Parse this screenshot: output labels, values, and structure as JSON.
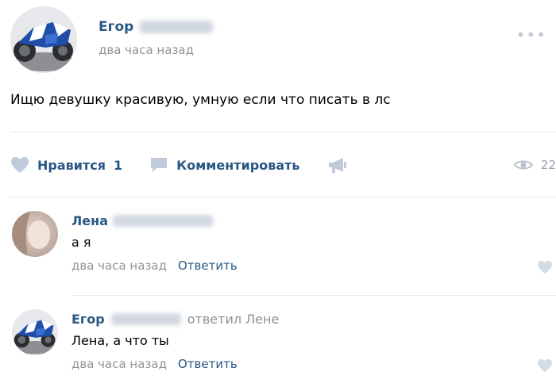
{
  "post": {
    "author": "Егор",
    "time": "два часа назад",
    "text": "Ищю девушку красивую, умную если что писать в лс",
    "more_icon": "dots-icon"
  },
  "actions": {
    "like_label": "Нравится",
    "like_count": "1",
    "comment_label": "Комментировать",
    "views_count": "22"
  },
  "comments": [
    {
      "author": "Лена",
      "text": "а я",
      "time": "два часа назад",
      "reply_label": "Ответить"
    },
    {
      "author": "Егор",
      "reply_to": "ответил Лене",
      "text": "Лена, а что ты",
      "time": "два часа назад",
      "reply_label": "Ответить"
    }
  ],
  "colors": {
    "link": "#2a5885",
    "meta": "#939393",
    "icon": "#bfcbdb"
  }
}
